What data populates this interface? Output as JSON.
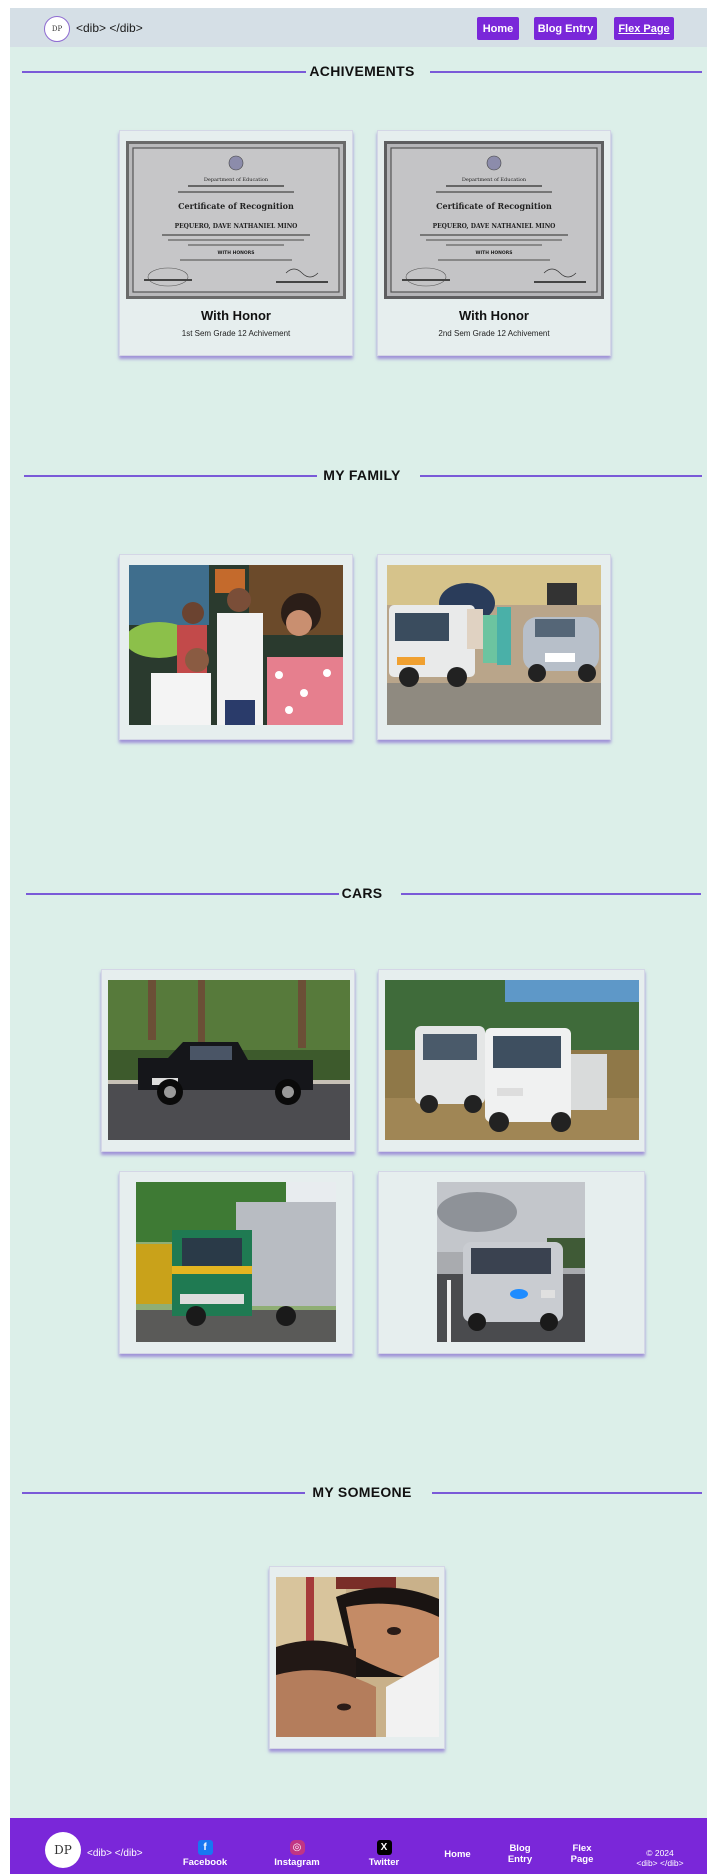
{
  "header": {
    "logo_text": "DP",
    "brand": "<dib> </dib>",
    "nav": [
      "Home",
      "Blog Entry",
      "Flex Page"
    ]
  },
  "sections": {
    "achievements": {
      "title": "ACHIVEMENTS",
      "cards": [
        {
          "title": "With Honor",
          "subtitle": "1st Sem Grade 12 Achivement",
          "certificate": {
            "header": "Department of Education",
            "title": "Certificate of Recognition",
            "name": "PEQUERO, DAVE NATHANIEL MINO",
            "award": "WITH HONORS"
          }
        },
        {
          "title": "With Honor",
          "subtitle": "2nd Sem Grade 12 Achivement",
          "certificate": {
            "header": "Department of Education",
            "title": "Certificate of Recognition",
            "name": "PEQUERO, DAVE NATHANIEL MINO",
            "award": "WITH HONORS"
          }
        }
      ]
    },
    "family": {
      "title": "MY FAMILY"
    },
    "cars": {
      "title": "CARS"
    },
    "someone": {
      "title": "MY SOMEONE"
    }
  },
  "footer": {
    "logo_text": "DP",
    "brand": "<dib> </dib>",
    "links": [
      {
        "label": "Facebook",
        "icon": "facebook-icon"
      },
      {
        "label": "Instagram",
        "icon": "instagram-icon"
      },
      {
        "label": "Twitter",
        "icon": "x-icon"
      }
    ],
    "nav": [
      "Home",
      "Blog Entry",
      "Flex Page"
    ],
    "copyright": "© 2024",
    "copyright_brand": "<dib> </dib>"
  },
  "colors": {
    "accent": "#7a27d9",
    "background": "#dcefe9",
    "header": "#d5dfe6",
    "heading_line": "#7a5ad8"
  }
}
